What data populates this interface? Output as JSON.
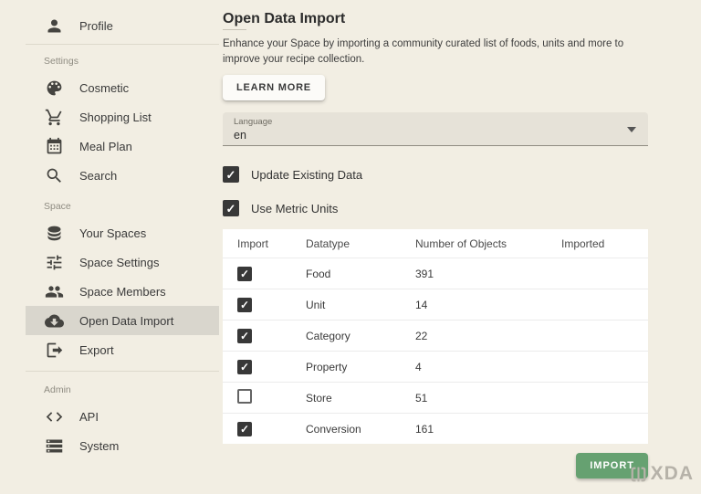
{
  "sidebar": {
    "profile": {
      "label": "Profile",
      "icon": "person-icon"
    },
    "sections": [
      {
        "title": "Settings",
        "items": [
          {
            "label": "Cosmetic",
            "icon": "palette-icon"
          },
          {
            "label": "Shopping List",
            "icon": "cart-icon"
          },
          {
            "label": "Meal Plan",
            "icon": "calendar-icon"
          },
          {
            "label": "Search",
            "icon": "search-icon"
          }
        ]
      },
      {
        "title": "Space",
        "items": [
          {
            "label": "Your Spaces",
            "icon": "database-icon"
          },
          {
            "label": "Space Settings",
            "icon": "tune-icon"
          },
          {
            "label": "Space Members",
            "icon": "group-icon"
          },
          {
            "label": "Open Data Import",
            "icon": "cloud-download-icon",
            "active": true
          },
          {
            "label": "Export",
            "icon": "export-icon"
          }
        ]
      },
      {
        "title": "Admin",
        "items": [
          {
            "label": "API",
            "icon": "code-icon"
          },
          {
            "label": "System",
            "icon": "server-icon"
          }
        ]
      }
    ]
  },
  "main": {
    "title": "Open Data Import",
    "description": "Enhance your Space by importing a community curated list of foods, units and more to improve your recipe collection.",
    "learn_more_label": "LEARN MORE",
    "language": {
      "label": "Language",
      "value": "en"
    },
    "options": [
      {
        "label": "Update Existing Data",
        "checked": true
      },
      {
        "label": "Use Metric Units",
        "checked": true
      }
    ],
    "table": {
      "headers": [
        "Import",
        "Datatype",
        "Number of Objects",
        "Imported"
      ],
      "rows": [
        {
          "checked": true,
          "datatype": "Food",
          "count": "391",
          "imported": ""
        },
        {
          "checked": true,
          "datatype": "Unit",
          "count": "14",
          "imported": ""
        },
        {
          "checked": true,
          "datatype": "Category",
          "count": "22",
          "imported": ""
        },
        {
          "checked": true,
          "datatype": "Property",
          "count": "4",
          "imported": ""
        },
        {
          "checked": false,
          "datatype": "Store",
          "count": "51",
          "imported": ""
        },
        {
          "checked": true,
          "datatype": "Conversion",
          "count": "161",
          "imported": ""
        }
      ]
    },
    "import_button_label": "IMPORT"
  },
  "watermark": {
    "text": "XDA"
  },
  "colors": {
    "background": "#f2eee3",
    "active_item": "#d9d6cd",
    "field": "#e6e2d8",
    "table_bg": "#ffffff",
    "checkbox": "#383838",
    "import_button": "#66a171"
  }
}
